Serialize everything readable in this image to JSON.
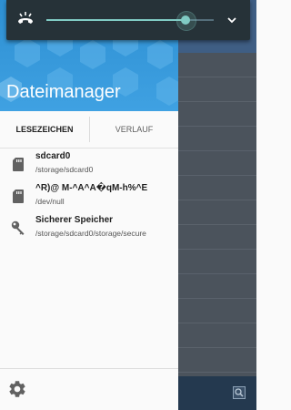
{
  "volume_panel": {
    "ringer_icon": "ringer-vibrate-icon",
    "level": 0.83,
    "expand_icon": "chevron-down-icon",
    "accent": "#80cbc4"
  },
  "drawer": {
    "title": "Dateimanager",
    "tabs": [
      {
        "label": "LESEZEICHEN",
        "active": true
      },
      {
        "label": "VERLAUF",
        "active": false
      }
    ],
    "items": [
      {
        "icon": "sd-card-icon",
        "name": "sdcard0",
        "path": "/storage/sdcard0"
      },
      {
        "icon": "sd-card-icon",
        "name": "^R)@ M-^A^A�qM-h%^E",
        "path": "/dev/null"
      },
      {
        "icon": "key-icon",
        "name": "Sicherer Speicher",
        "path": "/storage/sdcard0/storage/secure"
      }
    ],
    "settings_icon": "gear-icon",
    "header_color": "#3397d9"
  },
  "background_app": {
    "search_icon": "search-icon"
  }
}
